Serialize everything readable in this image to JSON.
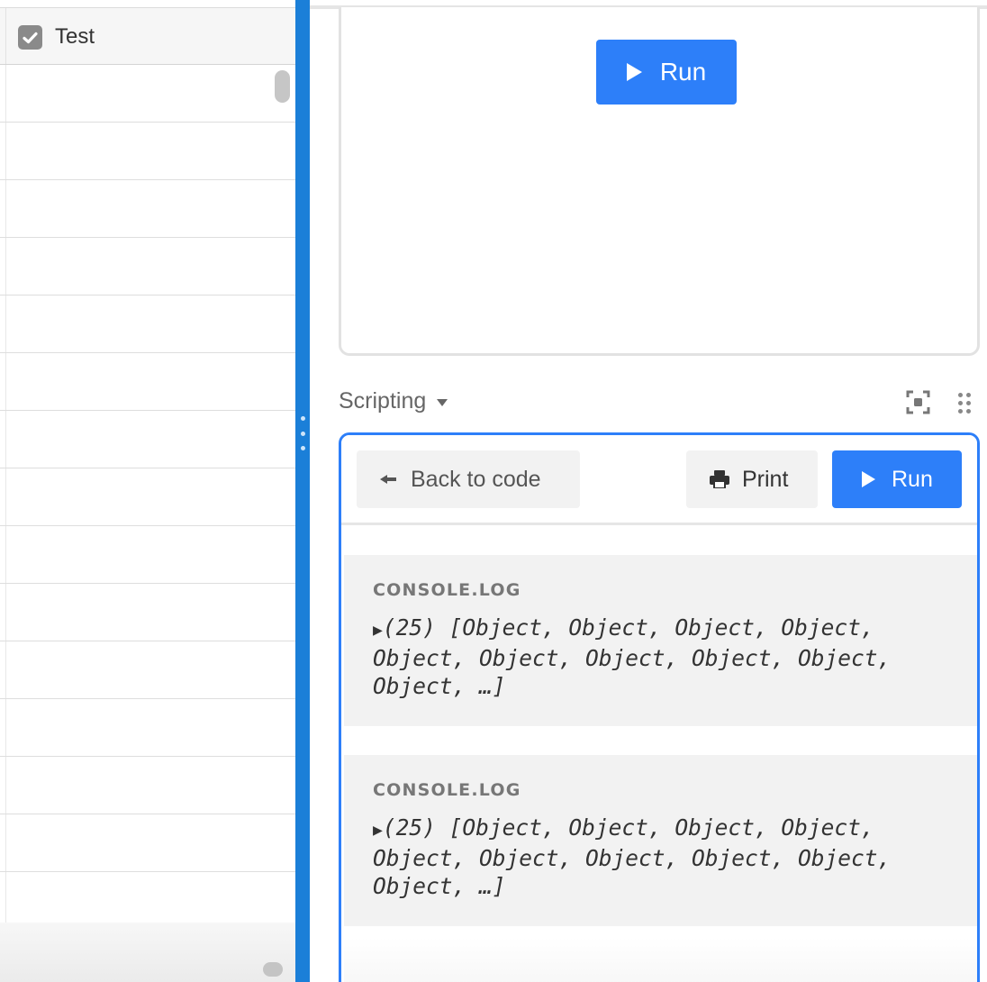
{
  "grid": {
    "field_name": "Test",
    "field_icon": "checkbox-icon",
    "row_count": 15
  },
  "app_block": {
    "run_label": "Run"
  },
  "scripting_block": {
    "title": "Scripting",
    "toolbar": {
      "back_label": "Back to code",
      "print_label": "Print",
      "run_label": "Run"
    },
    "console": [
      {
        "label": "CONSOLE.LOG",
        "expand_glyph": "▶",
        "text": "(25) [Object, Object, Object, Object, Object, Object, Object, Object, Object, Object, …]"
      },
      {
        "label": "CONSOLE.LOG",
        "expand_glyph": "▶",
        "text": "(25) [Object, Object, Object, Object, Object, Object, Object, Object, Object, Object, …]"
      }
    ]
  },
  "colors": {
    "accent": "#2d7ff9",
    "divider": "#1b7fd8",
    "console_bg": "#f2f2f2"
  }
}
